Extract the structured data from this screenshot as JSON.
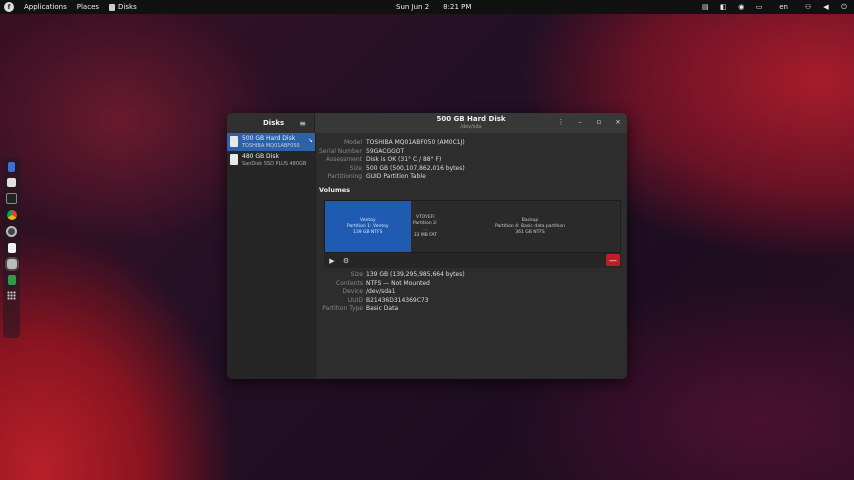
{
  "topbar": {
    "applications": "Applications",
    "places": "Places",
    "app": "Disks",
    "date": "Sun Jun 2",
    "time": "8:21 PM",
    "lang": "en"
  },
  "window": {
    "sidebar_title": "Disks",
    "title": "500 GB Hard Disk",
    "subtitle": "/dev/sda"
  },
  "disks": [
    {
      "name": "500 GB Hard Disk",
      "model": "TOSHIBA MQ01ABF050"
    },
    {
      "name": "480 GB Disk",
      "model": "SanDisk SSD PLUS 480GB"
    }
  ],
  "disk_info": {
    "model_label": "Model",
    "model": "TOSHIBA MQ01ABF050 (AM0C1J)",
    "serial_label": "Serial Number",
    "serial": "59GACGGOT",
    "assessment_label": "Assessment",
    "assessment": "Disk is OK (31° C / 88° F)",
    "size_label": "Size",
    "size": "500 GB (500,107,862,016 bytes)",
    "partitioning_label": "Partitioning",
    "partitioning": "GUID Partition Table"
  },
  "volumes": {
    "title": "Volumes",
    "segments": [
      {
        "l1": "Ventoy",
        "l2": "Partition 1: Ventoy",
        "l3": "139 GB NTFS",
        "share": 0.29
      },
      {
        "l1": "VTOYEFI",
        "l2": "Partition 2: ...",
        "l3": "33 MB FAT",
        "share": 0.1
      },
      {
        "l1": "Backup",
        "l2": "Partition 4: Basic data partition",
        "l3": "361 GB NTFS",
        "share": 0.61
      }
    ]
  },
  "partition_info": {
    "size_label": "Size",
    "size": "139 GB (139,295,985,664 bytes)",
    "contents_label": "Contents",
    "contents": "NTFS — Not Mounted",
    "device_label": "Device",
    "device": "/dev/sda1",
    "uuid_label": "UUID",
    "uuid": "B21436D314369C73",
    "ptype_label": "Partition Type",
    "ptype": "Basic Data"
  },
  "colors": {
    "selection": "#2c62a8",
    "segment_selected": "#1f5bb0",
    "delete": "#c01c28"
  },
  "icons": {
    "logo": "fedora-logo-icon",
    "menu": "hamburger-icon",
    "kebab": "kebab-menu-icon",
    "play": "play-icon",
    "settings": "gear-icon",
    "delete": "minus-icon"
  }
}
